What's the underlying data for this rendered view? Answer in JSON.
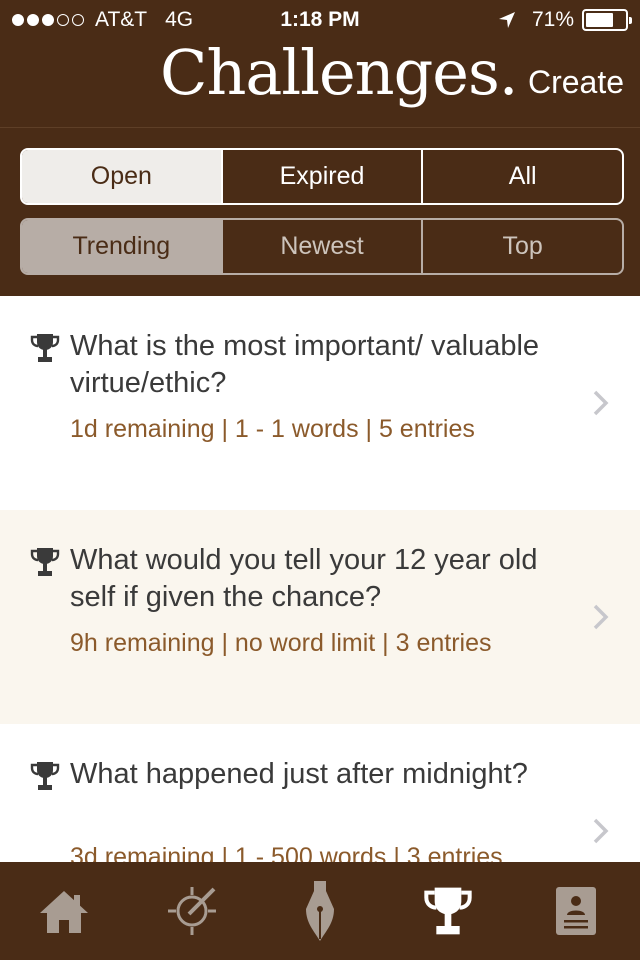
{
  "status_bar": {
    "carrier": "AT&T",
    "network": "4G",
    "time": "1:18 PM",
    "battery": "71%",
    "battery_level": 0.71,
    "signal_bars_filled": 3,
    "signal_bars_total": 5
  },
  "nav": {
    "title": "Challenges.",
    "create_label": "Create"
  },
  "filters": {
    "status": [
      "Open",
      "Expired",
      "All"
    ],
    "status_selected": "Open",
    "sort": [
      "Trending",
      "Newest",
      "Top"
    ],
    "sort_selected": "Trending"
  },
  "challenges": [
    {
      "question": "What is the most important/ valuable virtue/ethic?",
      "meta": "1d remaining  |  1 - 1 words  |  5 entries"
    },
    {
      "question": "What would you tell your 12 year old self if given the chance?",
      "meta": "9h remaining  |  no word limit  |  3 entries"
    },
    {
      "question": "What happened just after midnight?",
      "meta": "3d remaining  |  1 - 500 words  |  3 entries"
    }
  ],
  "tabbar": {
    "icons": [
      "home-icon",
      "compass-icon",
      "pen-nib-icon",
      "trophy-icon",
      "profile-icon"
    ],
    "active": "trophy-icon"
  },
  "colors": {
    "brand_brown": "#4a2c16",
    "meta_brown": "#8b5a2b",
    "alt_row": "#faf6ee",
    "tab_inactive": "#a89c92",
    "tab_active": "#ffffff"
  }
}
